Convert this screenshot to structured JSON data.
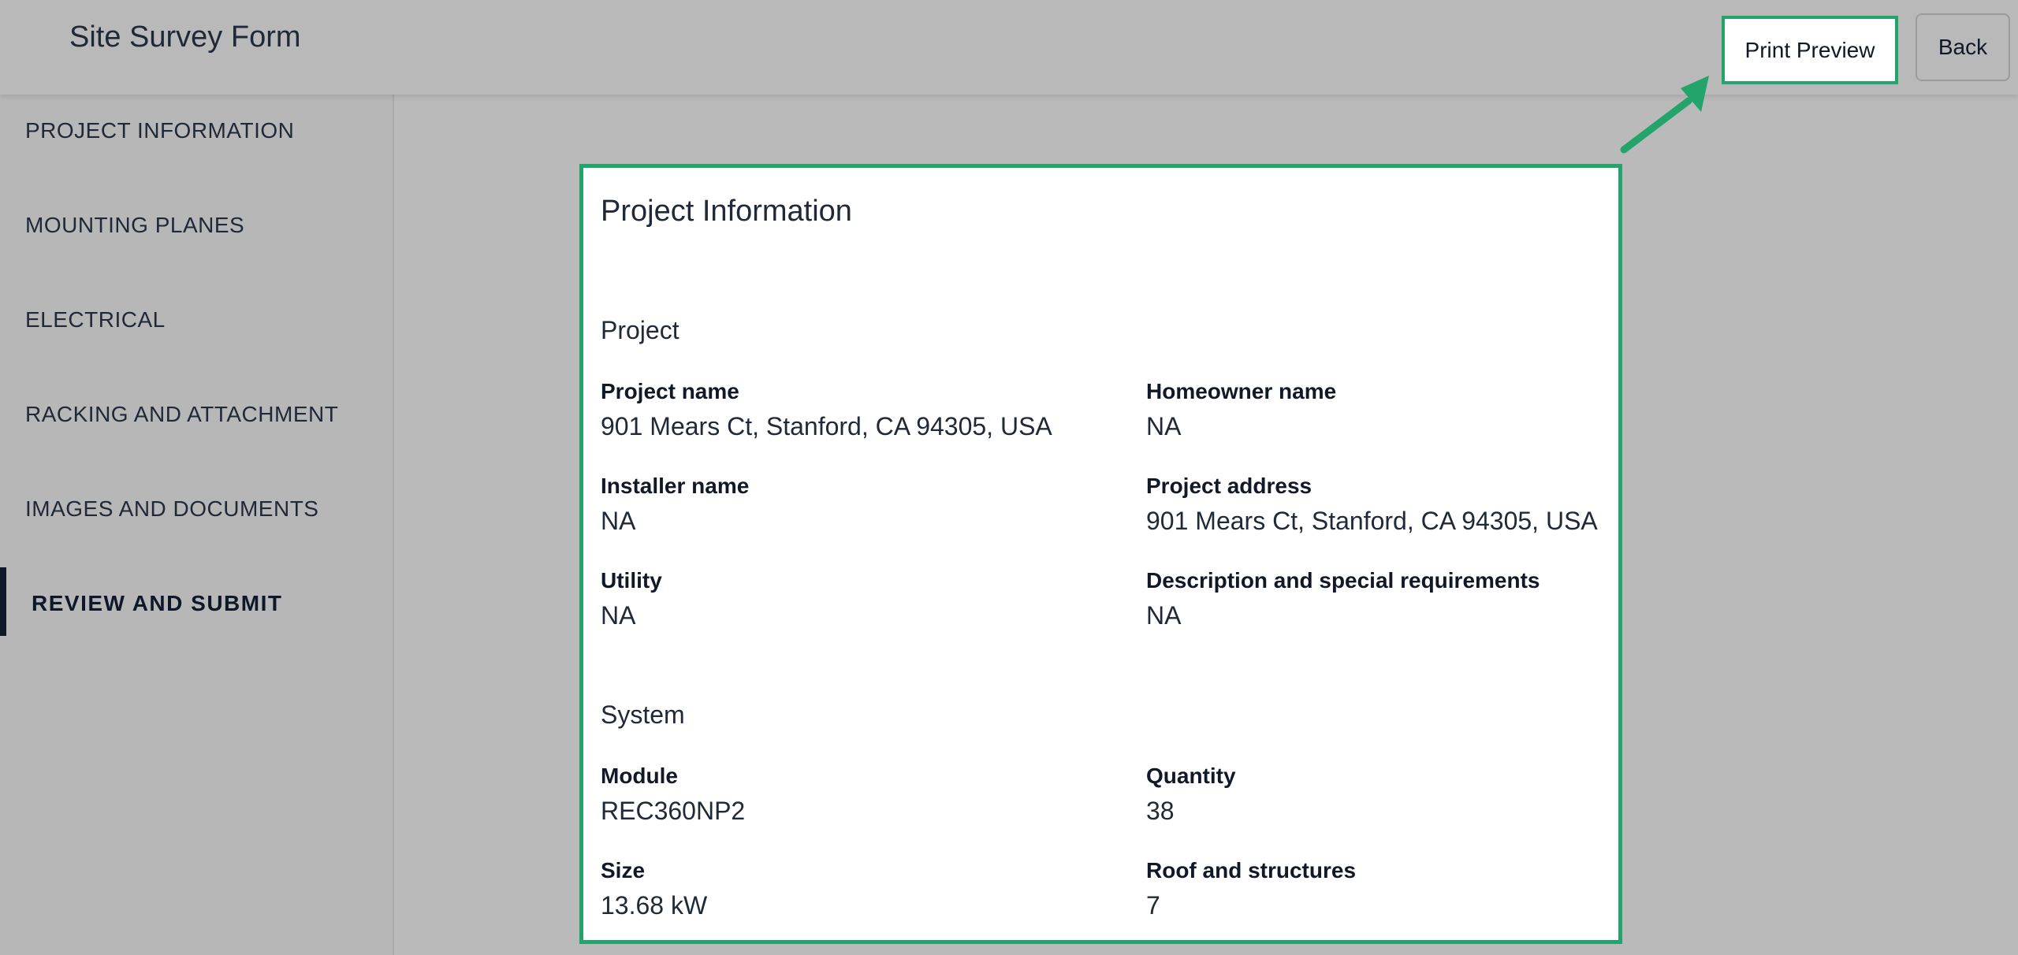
{
  "header": {
    "title": "Site Survey Form",
    "print_preview_label": "Print Preview",
    "back_label": "Back"
  },
  "sidebar": {
    "items": [
      {
        "label": "PROJECT INFORMATION"
      },
      {
        "label": "MOUNTING PLANES"
      },
      {
        "label": "ELECTRICAL"
      },
      {
        "label": "RACKING AND ATTACHMENT"
      },
      {
        "label": "IMAGES AND DOCUMENTS"
      },
      {
        "label": "REVIEW AND SUBMIT",
        "active": true
      }
    ]
  },
  "panel": {
    "title": "Project Information",
    "project_section": {
      "title": "Project",
      "fields": [
        {
          "label": "Project name",
          "value": "901 Mears Ct, Stanford, CA 94305, USA"
        },
        {
          "label": "Homeowner name",
          "value": "NA"
        },
        {
          "label": "Installer name",
          "value": "NA"
        },
        {
          "label": "Project address",
          "value": "901 Mears Ct, Stanford, CA 94305, USA"
        },
        {
          "label": "Utility",
          "value": "NA"
        },
        {
          "label": "Description and special requirements",
          "value": "NA"
        }
      ]
    },
    "system_section": {
      "title": "System",
      "fields": [
        {
          "label": "Module",
          "value": "REC360NP2"
        },
        {
          "label": "Quantity",
          "value": "38"
        },
        {
          "label": "Size",
          "value": "13.68 kW"
        },
        {
          "label": "Roof and structures",
          "value": "7"
        }
      ]
    }
  },
  "colors": {
    "accent_green": "#22a46b",
    "overlay_gray": "#bababa",
    "active_bar": "#0f172a"
  },
  "icons": {
    "annotation_arrow": "arrow-up-right-icon"
  }
}
